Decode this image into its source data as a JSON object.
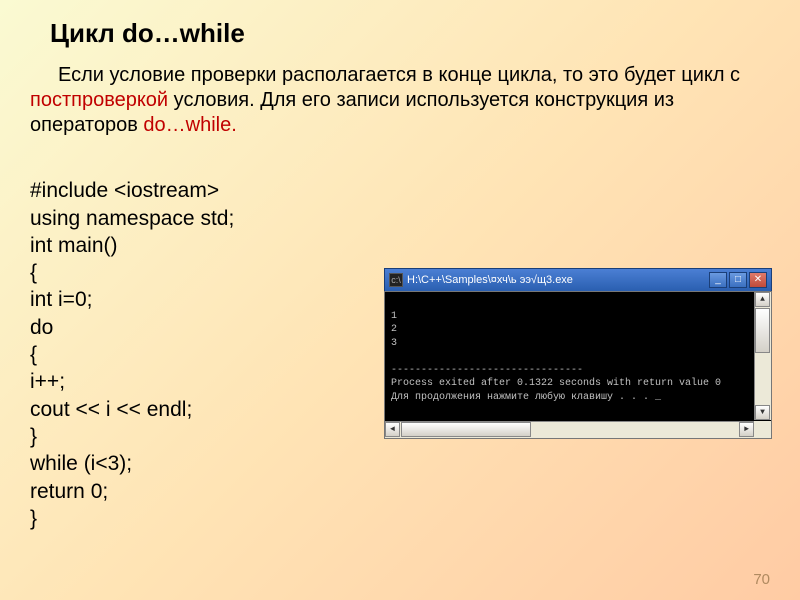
{
  "title": "Цикл do…while",
  "desc_part1": "Если условие проверки располагается в конце цикла, то это будет цикл с ",
  "desc_red1": "постпроверкой",
  "desc_part2": " условия. Для его записи используется конструкция из операторов ",
  "desc_red2": "do…while.",
  "code": {
    "l1": "#include <iostream>",
    "l2": "using namespace std;",
    "l3": "int main()",
    "l4": "{",
    "l5": "int i=0;",
    "l6": "do",
    "l7": "{",
    "l8": "i++;",
    "l9": "cout << i << endl;",
    "l10": "}",
    "l11": "while (i<3);",
    "l12": "return 0;",
    "l13": "}"
  },
  "console": {
    "title": "H:\\C++\\Samples\\¤хч\\ь ээ√щ3.exe",
    "out1": "1",
    "out2": "2",
    "out3": "3",
    "sep": "--------------------------------",
    "msg1": "Process exited after 0.1322 seconds with return value 0",
    "msg2": "Для продолжения нажмите любую клавишу . . . _"
  },
  "pagenum": "70",
  "glyph": {
    "min": "_",
    "max": "□",
    "close": "✕",
    "up": "▲",
    "down": "▼",
    "left": "◄",
    "right": "►",
    "cmd": "c:\\"
  }
}
